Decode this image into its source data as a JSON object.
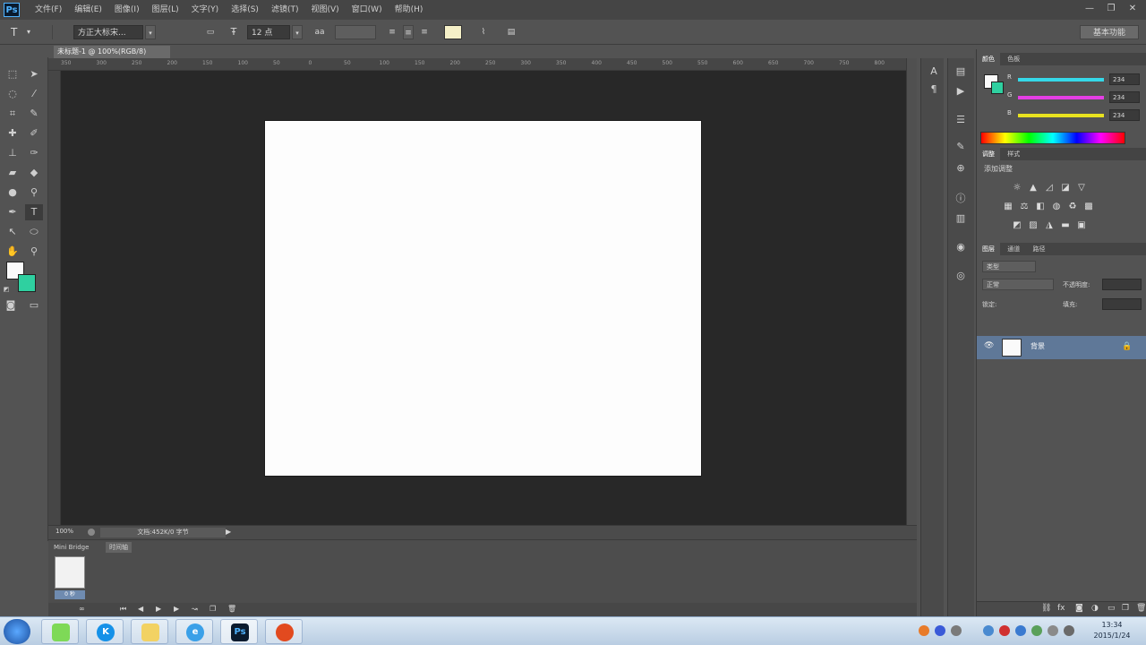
{
  "app": {
    "logo": "Ps"
  },
  "menu": [
    "文件(F)",
    "编辑(E)",
    "图像(I)",
    "图层(L)",
    "文字(Y)",
    "选择(S)",
    "滤镜(T)",
    "视图(V)",
    "窗口(W)",
    "帮助(H)"
  ],
  "window_controls": {
    "minimize": "—",
    "restore": "❐",
    "close": "✕"
  },
  "options": {
    "tool_icon": "T",
    "font_family": "方正大标宋...",
    "font_size": "12 点",
    "aa_icon": "aa",
    "workspace": "基本功能"
  },
  "document": {
    "tab_title": "未标题-1 @ 100%(RGB/8)"
  },
  "ruler_ticks": [
    "350",
    "300",
    "250",
    "200",
    "150",
    "100",
    "50",
    "0",
    "50",
    "100",
    "150",
    "200",
    "250",
    "300",
    "350",
    "400",
    "450",
    "500",
    "550",
    "600",
    "650",
    "700",
    "750",
    "800"
  ],
  "status": {
    "zoom": "100%",
    "info": "文档:452K/0 字节"
  },
  "bridge": {
    "tab1": "Mini Bridge",
    "tab2": "时间轴",
    "thumb_label": "0 秒"
  },
  "panels": {
    "color_tabs": [
      "颜色",
      "色板"
    ],
    "rgb": [
      {
        "label": "R",
        "value": "234",
        "color": "#35d8e8"
      },
      {
        "label": "G",
        "value": "234",
        "color": "#e43ee4"
      },
      {
        "label": "B",
        "value": "234",
        "color": "#e8e21f"
      }
    ],
    "adjust_tabs": [
      "调整",
      "样式"
    ],
    "adjust_title": "添加调整",
    "layers_tabs": [
      "图层",
      "通道",
      "路径"
    ],
    "layer_filter": "类型",
    "blend_mode": "正常",
    "opacity_label": "不透明度:",
    "lock_label": "锁定:",
    "fill_label": "填充:",
    "layer_name": "背景"
  },
  "taskbar": {
    "clock_time": "13:34",
    "clock_date": "2015/1/24"
  },
  "colors": {
    "foreground": "#fafafa",
    "background": "#2fd0a0",
    "accent": "#5f7898"
  }
}
